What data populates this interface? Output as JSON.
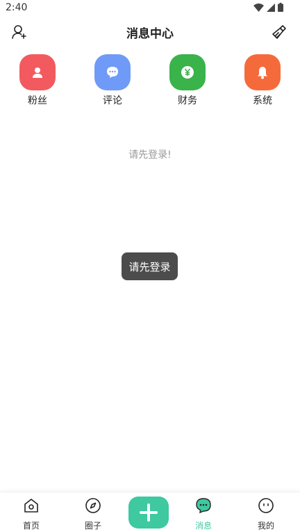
{
  "status_bar": {
    "time": "2:40"
  },
  "header": {
    "title": "消息中心"
  },
  "categories": [
    {
      "label": "粉丝",
      "color": "#f25a5f",
      "icon": "user-icon"
    },
    {
      "label": "评论",
      "color": "#6f9af7",
      "icon": "chat-bubble-icon"
    },
    {
      "label": "财务",
      "color": "#39b34a",
      "icon": "yen-coin-icon"
    },
    {
      "label": "系统",
      "color": "#f56a3b",
      "icon": "bell-icon"
    }
  ],
  "empty_message": "请先登录!",
  "toast": "请先登录",
  "bottom_nav": {
    "items": [
      {
        "label": "首页",
        "icon": "home-icon"
      },
      {
        "label": "圈子",
        "icon": "compass-icon"
      },
      {
        "label": "消息",
        "icon": "message-icon",
        "active": true
      },
      {
        "label": "我的",
        "icon": "profile-face-icon"
      }
    ],
    "add_icon": "plus-icon",
    "accent_color": "#3ec9a0"
  }
}
